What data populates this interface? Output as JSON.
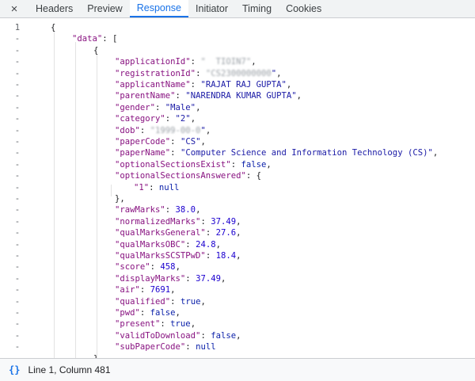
{
  "tabs": [
    {
      "label": "Headers",
      "active": false
    },
    {
      "label": "Preview",
      "active": false
    },
    {
      "label": "Response",
      "active": true
    },
    {
      "label": "Initiator",
      "active": false
    },
    {
      "label": "Timing",
      "active": false
    },
    {
      "label": "Cookies",
      "active": false
    }
  ],
  "close_icon": "×",
  "lines": [
    {
      "num": "1",
      "indent": 0,
      "parts": [
        [
          "p",
          "{"
        ]
      ]
    },
    {
      "num": "-",
      "indent": 1,
      "parts": [
        [
          "k",
          "\"data\""
        ],
        [
          "p",
          ": ["
        ]
      ]
    },
    {
      "num": "-",
      "indent": 2,
      "parts": [
        [
          "p",
          "{"
        ]
      ]
    },
    {
      "num": "-",
      "indent": 3,
      "parts": [
        [
          "k",
          "\"applicationId\""
        ],
        [
          "p",
          ": "
        ],
        [
          "b",
          "\"  TIOIN7\""
        ],
        [
          "p",
          ","
        ]
      ]
    },
    {
      "num": "-",
      "indent": 3,
      "parts": [
        [
          "k",
          "\"registrationId\""
        ],
        [
          "p",
          ": "
        ],
        [
          "b",
          "\"CS2300000000"
        ],
        [
          "s",
          "\""
        ],
        [
          "p",
          ","
        ]
      ]
    },
    {
      "num": "-",
      "indent": 3,
      "parts": [
        [
          "k",
          "\"applicantName\""
        ],
        [
          "p",
          ": "
        ],
        [
          "s",
          "\"RAJAT RAJ GUPTA\""
        ],
        [
          "p",
          ","
        ]
      ]
    },
    {
      "num": "-",
      "indent": 3,
      "parts": [
        [
          "k",
          "\"parentName\""
        ],
        [
          "p",
          ": "
        ],
        [
          "s",
          "\"NARENDRA KUMAR GUPTA\""
        ],
        [
          "p",
          ","
        ]
      ]
    },
    {
      "num": "-",
      "indent": 3,
      "parts": [
        [
          "k",
          "\"gender\""
        ],
        [
          "p",
          ": "
        ],
        [
          "s",
          "\"Male\""
        ],
        [
          "p",
          ","
        ]
      ]
    },
    {
      "num": "-",
      "indent": 3,
      "parts": [
        [
          "k",
          "\"category\""
        ],
        [
          "p",
          ": "
        ],
        [
          "s",
          "\"2\""
        ],
        [
          "p",
          ","
        ]
      ]
    },
    {
      "num": "-",
      "indent": 3,
      "parts": [
        [
          "k",
          "\"dob\""
        ],
        [
          "p",
          ": "
        ],
        [
          "b",
          "\"1999-00-0"
        ],
        [
          "s",
          "\""
        ],
        [
          "p",
          ","
        ]
      ]
    },
    {
      "num": "-",
      "indent": 3,
      "parts": [
        [
          "k",
          "\"paperCode\""
        ],
        [
          "p",
          ": "
        ],
        [
          "s",
          "\"CS\""
        ],
        [
          "p",
          ","
        ]
      ]
    },
    {
      "num": "-",
      "indent": 3,
      "parts": [
        [
          "k",
          "\"paperName\""
        ],
        [
          "p",
          ": "
        ],
        [
          "s",
          "\"Computer Science and Information Technology (CS)\""
        ],
        [
          "p",
          ","
        ]
      ]
    },
    {
      "num": "-",
      "indent": 3,
      "parts": [
        [
          "k",
          "\"optionalSectionsExist\""
        ],
        [
          "p",
          ": "
        ],
        [
          "l",
          "false"
        ],
        [
          "p",
          ","
        ]
      ]
    },
    {
      "num": "-",
      "indent": 3,
      "parts": [
        [
          "k",
          "\"optionalSectionsAnswered\""
        ],
        [
          "p",
          ": {"
        ]
      ]
    },
    {
      "num": "-",
      "indent": 4,
      "parts": [
        [
          "k",
          "\"1\""
        ],
        [
          "p",
          ": "
        ],
        [
          "l",
          "null"
        ]
      ]
    },
    {
      "num": "-",
      "indent": 3,
      "parts": [
        [
          "p",
          "},"
        ]
      ]
    },
    {
      "num": "-",
      "indent": 3,
      "parts": [
        [
          "k",
          "\"rawMarks\""
        ],
        [
          "p",
          ": "
        ],
        [
          "n",
          "38.0"
        ],
        [
          "p",
          ","
        ]
      ]
    },
    {
      "num": "-",
      "indent": 3,
      "parts": [
        [
          "k",
          "\"normalizedMarks\""
        ],
        [
          "p",
          ": "
        ],
        [
          "n",
          "37.49"
        ],
        [
          "p",
          ","
        ]
      ]
    },
    {
      "num": "-",
      "indent": 3,
      "parts": [
        [
          "k",
          "\"qualMarksGeneral\""
        ],
        [
          "p",
          ": "
        ],
        [
          "n",
          "27.6"
        ],
        [
          "p",
          ","
        ]
      ]
    },
    {
      "num": "-",
      "indent": 3,
      "parts": [
        [
          "k",
          "\"qualMarksOBC\""
        ],
        [
          "p",
          ": "
        ],
        [
          "n",
          "24.8"
        ],
        [
          "p",
          ","
        ]
      ]
    },
    {
      "num": "-",
      "indent": 3,
      "parts": [
        [
          "k",
          "\"qualMarksSCSTPwD\""
        ],
        [
          "p",
          ": "
        ],
        [
          "n",
          "18.4"
        ],
        [
          "p",
          ","
        ]
      ]
    },
    {
      "num": "-",
      "indent": 3,
      "parts": [
        [
          "k",
          "\"score\""
        ],
        [
          "p",
          ": "
        ],
        [
          "n",
          "458"
        ],
        [
          "p",
          ","
        ]
      ]
    },
    {
      "num": "-",
      "indent": 3,
      "parts": [
        [
          "k",
          "\"displayMarks\""
        ],
        [
          "p",
          ": "
        ],
        [
          "n",
          "37.49"
        ],
        [
          "p",
          ","
        ]
      ]
    },
    {
      "num": "-",
      "indent": 3,
      "parts": [
        [
          "k",
          "\"air\""
        ],
        [
          "p",
          ": "
        ],
        [
          "n",
          "7691"
        ],
        [
          "p",
          ","
        ]
      ]
    },
    {
      "num": "-",
      "indent": 3,
      "parts": [
        [
          "k",
          "\"qualified\""
        ],
        [
          "p",
          ": "
        ],
        [
          "l",
          "true"
        ],
        [
          "p",
          ","
        ]
      ]
    },
    {
      "num": "-",
      "indent": 3,
      "parts": [
        [
          "k",
          "\"pwd\""
        ],
        [
          "p",
          ": "
        ],
        [
          "l",
          "false"
        ],
        [
          "p",
          ","
        ]
      ]
    },
    {
      "num": "-",
      "indent": 3,
      "parts": [
        [
          "k",
          "\"present\""
        ],
        [
          "p",
          ": "
        ],
        [
          "l",
          "true"
        ],
        [
          "p",
          ","
        ]
      ]
    },
    {
      "num": "-",
      "indent": 3,
      "parts": [
        [
          "k",
          "\"validToDownload\""
        ],
        [
          "p",
          ": "
        ],
        [
          "l",
          "false"
        ],
        [
          "p",
          ","
        ]
      ]
    },
    {
      "num": "-",
      "indent": 3,
      "parts": [
        [
          "k",
          "\"subPaperCode\""
        ],
        [
          "p",
          ": "
        ],
        [
          "l",
          "null"
        ]
      ]
    },
    {
      "num": "-",
      "indent": 2,
      "parts": [
        [
          "p",
          "}"
        ]
      ]
    }
  ],
  "status": {
    "icon": "{}",
    "position": "Line 1, Column 481"
  }
}
